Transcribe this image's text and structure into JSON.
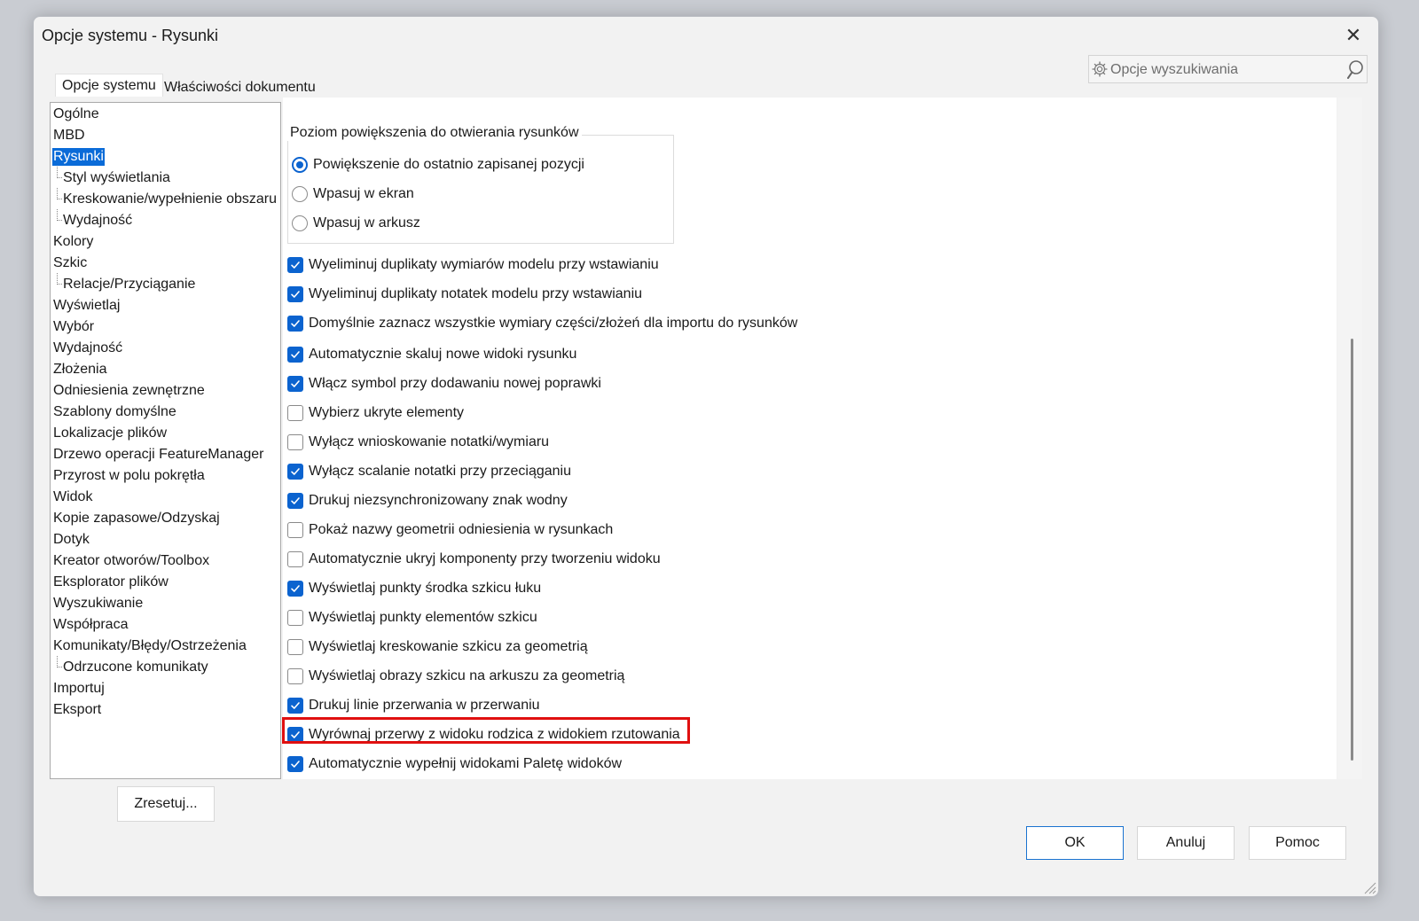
{
  "window": {
    "title": "Opcje systemu - Rysunki",
    "close_glyph": "✕"
  },
  "tabs": [
    {
      "label": "Opcje systemu",
      "active": true
    },
    {
      "label": "Właściwości dokumentu",
      "active": false
    }
  ],
  "search": {
    "placeholder": "Opcje wyszukiwania",
    "icon": "gear-icon",
    "button_icon": "magnifier-icon"
  },
  "tree": {
    "items": [
      {
        "label": "Ogólne",
        "level": 0,
        "selected": false
      },
      {
        "label": "MBD",
        "level": 0,
        "selected": false
      },
      {
        "label": "Rysunki",
        "level": 0,
        "selected": true
      },
      {
        "label": "Styl wyświetlania",
        "level": 1,
        "selected": false
      },
      {
        "label": "Kreskowanie/wypełnienie obszaru",
        "level": 1,
        "selected": false
      },
      {
        "label": "Wydajność",
        "level": 1,
        "selected": false
      },
      {
        "label": "Kolory",
        "level": 0,
        "selected": false
      },
      {
        "label": "Szkic",
        "level": 0,
        "selected": false
      },
      {
        "label": "Relacje/Przyciąganie",
        "level": 1,
        "selected": false
      },
      {
        "label": "Wyświetlaj",
        "level": 0,
        "selected": false
      },
      {
        "label": "Wybór",
        "level": 0,
        "selected": false
      },
      {
        "label": "Wydajność",
        "level": 0,
        "selected": false
      },
      {
        "label": "Złożenia",
        "level": 0,
        "selected": false
      },
      {
        "label": "Odniesienia zewnętrzne",
        "level": 0,
        "selected": false
      },
      {
        "label": "Szablony domyślne",
        "level": 0,
        "selected": false
      },
      {
        "label": "Lokalizacje plików",
        "level": 0,
        "selected": false
      },
      {
        "label": "Drzewo operacji FeatureManager",
        "level": 0,
        "selected": false
      },
      {
        "label": "Przyrost w polu pokrętła",
        "level": 0,
        "selected": false
      },
      {
        "label": "Widok",
        "level": 0,
        "selected": false
      },
      {
        "label": "Kopie zapasowe/Odzyskaj",
        "level": 0,
        "selected": false
      },
      {
        "label": "Dotyk",
        "level": 0,
        "selected": false
      },
      {
        "label": "Kreator otworów/Toolbox",
        "level": 0,
        "selected": false
      },
      {
        "label": "Eksplorator plików",
        "level": 0,
        "selected": false
      },
      {
        "label": "Wyszukiwanie",
        "level": 0,
        "selected": false
      },
      {
        "label": "Współpraca",
        "level": 0,
        "selected": false
      },
      {
        "label": "Komunikaty/Błędy/Ostrzeżenia",
        "level": 0,
        "selected": false
      },
      {
        "label": "Odrzucone komunikaty",
        "level": 1,
        "selected": false
      },
      {
        "label": "Importuj",
        "level": 0,
        "selected": false
      },
      {
        "label": "Eksport",
        "level": 0,
        "selected": false
      }
    ],
    "reset_label": "Zresetuj..."
  },
  "zoom_group": {
    "title": "Poziom powiększenia do otwierania rysunków",
    "options": [
      {
        "label": "Powiększenie do ostatnio zapisanej pozycji",
        "selected": true
      },
      {
        "label": "Wpasuj w ekran",
        "selected": false
      },
      {
        "label": "Wpasuj w arkusz",
        "selected": false
      }
    ]
  },
  "checkboxes": [
    {
      "label": "Wyeliminuj duplikaty wymiarów modelu przy wstawianiu",
      "checked": true
    },
    {
      "label": "Wyeliminuj duplikaty notatek modelu przy wstawianiu",
      "checked": true
    },
    {
      "label": "Domyślnie zaznacz wszystkie wymiary części/złożeń dla importu do rysunków",
      "checked": true
    },
    {
      "label": "Automatycznie skaluj nowe widoki rysunku",
      "checked": true
    },
    {
      "label": "Włącz symbol przy dodawaniu nowej poprawki",
      "checked": true
    },
    {
      "label": "Wybierz ukryte elementy",
      "checked": false
    },
    {
      "label": "Wyłącz wnioskowanie notatki/wymiaru",
      "checked": false
    },
    {
      "label": "Wyłącz scalanie notatki przy przeciąganiu",
      "checked": true
    },
    {
      "label": "Drukuj niezsynchronizowany znak wodny",
      "checked": true
    },
    {
      "label": "Pokaż nazwy geometrii odniesienia w rysunkach",
      "checked": false
    },
    {
      "label": "Automatycznie ukryj komponenty przy tworzeniu widoku",
      "checked": false
    },
    {
      "label": "Wyświetlaj punkty środka szkicu łuku",
      "checked": true
    },
    {
      "label": "Wyświetlaj punkty elementów szkicu",
      "checked": false
    },
    {
      "label": "Wyświetlaj kreskowanie szkicu za geometrią",
      "checked": false
    },
    {
      "label": "Wyświetlaj obrazy szkicu na arkuszu za geometrią",
      "checked": false
    },
    {
      "label": "Drukuj linie przerwania w przerwaniu",
      "checked": true
    },
    {
      "label": "Wyrównaj przerwy z widoku rodzica z widokiem rzutowania",
      "checked": true,
      "highlighted": true
    },
    {
      "label": "Automatycznie wypełnij widokami Paletę widoków",
      "checked": true
    }
  ],
  "footer": {
    "ok": "OK",
    "cancel": "Anuluj",
    "help": "Pomoc"
  },
  "colors": {
    "accent": "#0b63cf",
    "selection": "#0a6bd8",
    "highlight_border": "#e01010"
  }
}
